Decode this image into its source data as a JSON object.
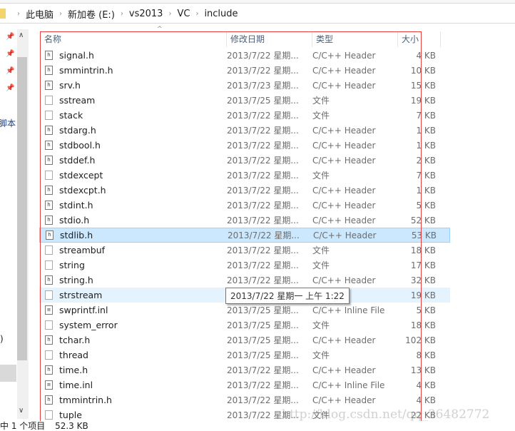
{
  "breadcrumb": [
    "此电脑",
    "新加卷 (E:)",
    "vs2013",
    "VC",
    "include"
  ],
  "nav": {
    "partial_label_1": "脚本",
    "partial_label_2": ":)"
  },
  "columns": {
    "name": "名称",
    "date": "修改日期",
    "type": "类型",
    "size": "大小"
  },
  "files": [
    {
      "name": "signal.h",
      "icon": "header-file-icon",
      "date": "2013/7/22 星期...",
      "type": "C/C++ Header",
      "size": "4 KB"
    },
    {
      "name": "smmintrin.h",
      "icon": "header-file-icon",
      "date": "2013/7/22 星期...",
      "type": "C/C++ Header",
      "size": "10 KB"
    },
    {
      "name": "srv.h",
      "icon": "header-file-icon",
      "date": "2013/7/23 星期...",
      "type": "C/C++ Header",
      "size": "15 KB"
    },
    {
      "name": "sstream",
      "icon": "blank-file-icon",
      "date": "2013/7/25 星期...",
      "type": "文件",
      "size": "19 KB"
    },
    {
      "name": "stack",
      "icon": "blank-file-icon",
      "date": "2013/7/22 星期...",
      "type": "文件",
      "size": "7 KB"
    },
    {
      "name": "stdarg.h",
      "icon": "header-file-icon",
      "date": "2013/7/22 星期...",
      "type": "C/C++ Header",
      "size": "1 KB"
    },
    {
      "name": "stdbool.h",
      "icon": "header-file-icon",
      "date": "2013/7/22 星期...",
      "type": "C/C++ Header",
      "size": "1 KB"
    },
    {
      "name": "stddef.h",
      "icon": "header-file-icon",
      "date": "2013/7/22 星期...",
      "type": "C/C++ Header",
      "size": "2 KB"
    },
    {
      "name": "stdexcept",
      "icon": "blank-file-icon",
      "date": "2013/7/22 星期...",
      "type": "文件",
      "size": "7 KB"
    },
    {
      "name": "stdexcpt.h",
      "icon": "header-file-icon",
      "date": "2013/7/22 星期...",
      "type": "C/C++ Header",
      "size": "1 KB"
    },
    {
      "name": "stdint.h",
      "icon": "header-file-icon",
      "date": "2013/7/22 星期...",
      "type": "C/C++ Header",
      "size": "5 KB"
    },
    {
      "name": "stdio.h",
      "icon": "header-file-icon",
      "date": "2013/7/22 星期...",
      "type": "C/C++ Header",
      "size": "52 KB"
    },
    {
      "name": "stdlib.h",
      "icon": "header-file-icon",
      "date": "2013/7/22 星期...",
      "type": "C/C++ Header",
      "size": "53 KB",
      "selected": true
    },
    {
      "name": "streambuf",
      "icon": "blank-file-icon",
      "date": "2013/7/22 星期...",
      "type": "文件",
      "size": "18 KB"
    },
    {
      "name": "string",
      "icon": "blank-file-icon",
      "date": "2013/7/22 星期...",
      "type": "文件",
      "size": "17 KB"
    },
    {
      "name": "string.h",
      "icon": "header-file-icon",
      "date": "2013/7/22 星期...",
      "type": "C/C++ Header",
      "size": "32 KB"
    },
    {
      "name": "strstream",
      "icon": "blank-file-icon",
      "date": "",
      "type": "",
      "size": "19 KB",
      "hovered": true
    },
    {
      "name": "swprintf.inl",
      "icon": "inline-file-icon",
      "date": "2013/7/25 星期...",
      "type": "C/C++ Inline File",
      "size": "5 KB"
    },
    {
      "name": "system_error",
      "icon": "blank-file-icon",
      "date": "2013/7/25 星期...",
      "type": "文件",
      "size": "18 KB"
    },
    {
      "name": "tchar.h",
      "icon": "header-file-icon",
      "date": "2013/7/25 星期...",
      "type": "C/C++ Header",
      "size": "102 KB"
    },
    {
      "name": "thread",
      "icon": "blank-file-icon",
      "date": "2013/7/25 星期...",
      "type": "文件",
      "size": "8 KB"
    },
    {
      "name": "time.h",
      "icon": "header-file-icon",
      "date": "2013/7/22 星期...",
      "type": "C/C++ Header",
      "size": "13 KB"
    },
    {
      "name": "time.inl",
      "icon": "inline-file-icon",
      "date": "2013/7/22 星期...",
      "type": "C/C++ Inline File",
      "size": "4 KB"
    },
    {
      "name": "tmmintrin.h",
      "icon": "header-file-icon",
      "date": "2013/7/22 星期...",
      "type": "C/C++ Header",
      "size": "4 KB"
    },
    {
      "name": "tuple",
      "icon": "blank-file-icon",
      "date": "2013/7/22 星期...",
      "type": "文件",
      "size": "22 KB"
    }
  ],
  "tooltip": "2013/7/22 星期一 上午 1:22",
  "status": {
    "items": "中 1 个项目",
    "size": "52.3 KB"
  },
  "watermark": "http://blog.csdn.net/qq_36482772",
  "colors": {
    "highlight_box": "#e8403f",
    "selected_row": "#cce8ff",
    "hover_row": "#e5f3ff"
  }
}
